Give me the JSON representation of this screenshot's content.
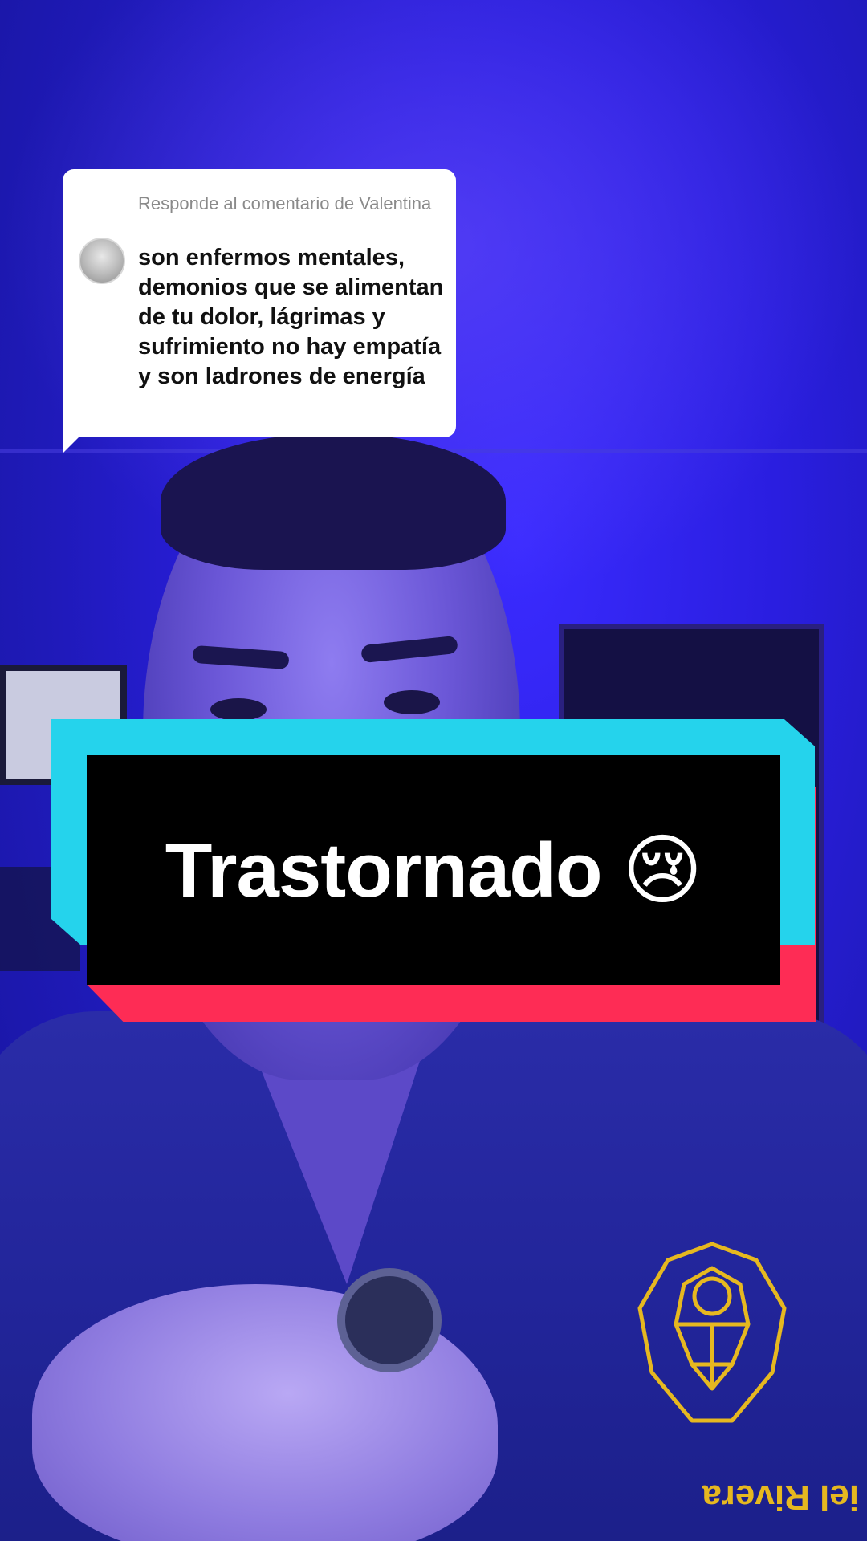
{
  "comment": {
    "reply_label": "Responde al comentario de Valentina",
    "text": "son enfermos mentales, demonios que se alimentan de tu dolor, lágrimas y sufrimiento no hay empatía y son ladrones de energía",
    "avatar_icon": "lion-avatar-icon"
  },
  "caption": {
    "text": "Trastornado 😢",
    "colors": {
      "box": "#000000",
      "shadow_cyan": "#25d3ec",
      "shadow_red": "#fe2c55"
    }
  },
  "scene": {
    "logo_text": "iel Rivera"
  }
}
